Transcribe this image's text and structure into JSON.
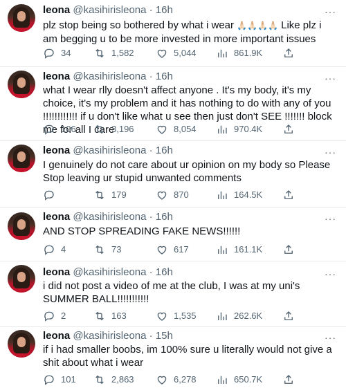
{
  "tweets": [
    {
      "name": "leona",
      "handle": "@kasihirisleona",
      "sep": "·",
      "time": "16h",
      "text_before": "plz stop being so bothered by what i wear ",
      "emoji": "🙏🏻🙏🏻🙏🏻🙏🏻",
      "text_after": " Like plz i am begging u to be more invested in more important issues",
      "replies": "34",
      "retweets": "1,582",
      "likes": "5,044",
      "views": "861.9K"
    },
    {
      "name": "leona",
      "handle": "@kasihirisleona",
      "sep": "·",
      "time": "16h",
      "text": "what I wear rlly doesn't affect anyone . It's my body, it's my choice, it's my problem and it has nothing to do with any of you !!!!!!!!!!!! if u don't like what u see then just don't SEE !!!!!!! block me for all I care",
      "replies": "106",
      "retweets": "3,196",
      "likes": "8,054",
      "views": "970.4K"
    },
    {
      "name": "leona",
      "handle": "@kasihirisleona",
      "sep": "·",
      "time": "16h",
      "text": "I genuinely do not care about ur opinion on my body so Please Stop leaving ur stupid unwanted comments",
      "replies": "",
      "retweets": "179",
      "likes": "870",
      "views": "164.5K"
    },
    {
      "name": "leona",
      "handle": "@kasihirisleona",
      "sep": "·",
      "time": "16h",
      "text": "AND STOP SPREADING FAKE NEWS!!!!!!",
      "replies": "4",
      "retweets": "73",
      "likes": "617",
      "views": "161.1K"
    },
    {
      "name": "leona",
      "handle": "@kasihirisleona",
      "sep": "·",
      "time": "16h",
      "text": "i did not post a video of me at the club, I was at my uni's SUMMER BALL!!!!!!!!!!!",
      "replies": "2",
      "retweets": "163",
      "likes": "1,535",
      "views": "262.6K"
    },
    {
      "name": "leona",
      "handle": "@kasihirisleona",
      "sep": "·",
      "time": "15h",
      "text": "if i had smaller boobs, im 100% sure u literally would not give a shit about what i wear",
      "replies": "101",
      "retweets": "2,863",
      "likes": "6,278",
      "views": "650.7K"
    }
  ],
  "icons": {
    "reply": "reply-icon",
    "retweet": "retweet-icon",
    "like": "heart-icon",
    "views": "views-icon",
    "share": "share-icon",
    "more": "more-icon"
  },
  "colors": {
    "text": "#0f1419",
    "muted": "#536471",
    "divider": "#e7e9ea"
  },
  "more_glyph": "···"
}
